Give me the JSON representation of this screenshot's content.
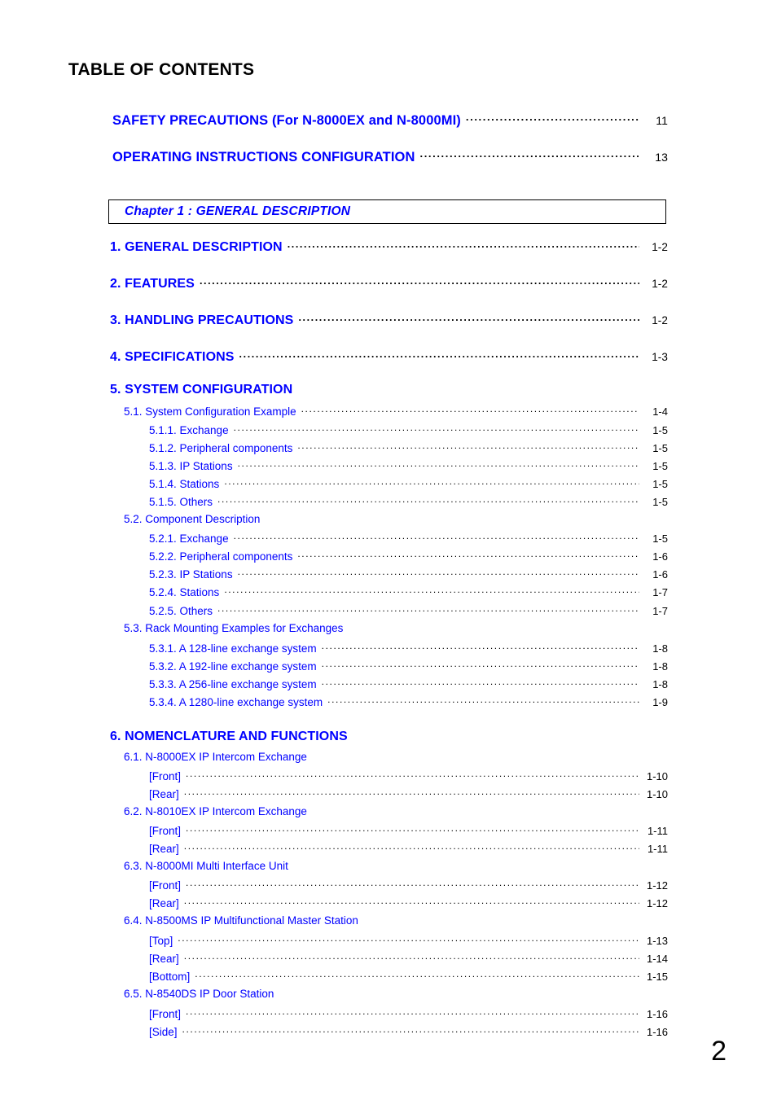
{
  "document": {
    "title": "TABLE OF CONTENTS",
    "page_number": "2",
    "colors": {
      "entry_text": "#0000FF",
      "title_text": "#000000",
      "leader_and_page": "#000000",
      "chapter_box_border": "#000000"
    }
  },
  "front_matter": [
    {
      "label": "SAFETY PRECAUTIONS (For N-8000EX and N-8000MI)",
      "page": "11"
    },
    {
      "label": "OPERATING INSTRUCTIONS CONFIGURATION",
      "page": "13"
    }
  ],
  "chapter_banner": {
    "label": "Chapter 1 : GENERAL DESCRIPTION"
  },
  "entries": [
    {
      "level": 1,
      "label": "1. GENERAL DESCRIPTION",
      "page": "1-2"
    },
    {
      "level": 1,
      "label": "2. FEATURES",
      "page": "1-2"
    },
    {
      "level": 1,
      "label": "3. HANDLING PRECAUTIONS",
      "page": "1-2"
    },
    {
      "level": 1,
      "label": "4. SPECIFICATIONS",
      "page": "1-3"
    },
    {
      "level": 1,
      "label": "5. SYSTEM CONFIGURATION",
      "page": ""
    },
    {
      "level": 2,
      "label": "5.1. System Configuration Example",
      "page": "1-4"
    },
    {
      "level": 3,
      "label": "5.1.1. Exchange",
      "page": "1-5"
    },
    {
      "level": 3,
      "label": "5.1.2. Peripheral components",
      "page": "1-5"
    },
    {
      "level": 3,
      "label": "5.1.3. IP Stations",
      "page": "1-5"
    },
    {
      "level": 3,
      "label": "5.1.4. Stations",
      "page": "1-5"
    },
    {
      "level": 3,
      "label": "5.1.5. Others",
      "page": "1-5"
    },
    {
      "level": 2,
      "label": "5.2. Component Description",
      "page": ""
    },
    {
      "level": 3,
      "label": "5.2.1. Exchange",
      "page": "1-5"
    },
    {
      "level": 3,
      "label": "5.2.2. Peripheral components",
      "page": "1-6"
    },
    {
      "level": 3,
      "label": "5.2.3. IP Stations",
      "page": "1-6"
    },
    {
      "level": 3,
      "label": "5.2.4. Stations",
      "page": "1-7"
    },
    {
      "level": 3,
      "label": "5.2.5. Others",
      "page": "1-7"
    },
    {
      "level": 2,
      "label": "5.3. Rack Mounting Examples for Exchanges",
      "page": ""
    },
    {
      "level": 3,
      "label": "5.3.1. A 128-line exchange system",
      "page": "1-8"
    },
    {
      "level": 3,
      "label": "5.3.2. A 192-line exchange system",
      "page": "1-8"
    },
    {
      "level": 3,
      "label": "5.3.3. A 256-line exchange system",
      "page": "1-8"
    },
    {
      "level": 3,
      "label": "5.3.4. A 1280-line exchange system",
      "page": "1-9"
    },
    {
      "level": 1,
      "label": "6. NOMENCLATURE AND FUNCTIONS",
      "page": ""
    },
    {
      "level": 2,
      "label": "6.1. N-8000EX IP Intercom Exchange",
      "page": ""
    },
    {
      "level": 3,
      "label": "[Front]",
      "page": "1-10"
    },
    {
      "level": 3,
      "label": "[Rear]",
      "page": "1-10"
    },
    {
      "level": 2,
      "label": "6.2. N-8010EX IP Intercom Exchange",
      "page": ""
    },
    {
      "level": 3,
      "label": "[Front]",
      "page": "1-11"
    },
    {
      "level": 3,
      "label": "[Rear]",
      "page": "1-11"
    },
    {
      "level": 2,
      "label": "6.3. N-8000MI Multi Interface Unit",
      "page": ""
    },
    {
      "level": 3,
      "label": "[Front]",
      "page": "1-12"
    },
    {
      "level": 3,
      "label": "[Rear]",
      "page": "1-12"
    },
    {
      "level": 2,
      "label": "6.4. N-8500MS IP Multifunctional Master Station",
      "page": ""
    },
    {
      "level": 3,
      "label": "[Top]",
      "page": "1-13"
    },
    {
      "level": 3,
      "label": "[Rear]",
      "page": "1-14"
    },
    {
      "level": 3,
      "label": "[Bottom]",
      "page": "1-15"
    },
    {
      "level": 2,
      "label": "6.5. N-8540DS IP Door Station",
      "page": ""
    },
    {
      "level": 3,
      "label": "[Front]",
      "page": "1-16"
    },
    {
      "level": 3,
      "label": "[Side]",
      "page": "1-16"
    }
  ]
}
